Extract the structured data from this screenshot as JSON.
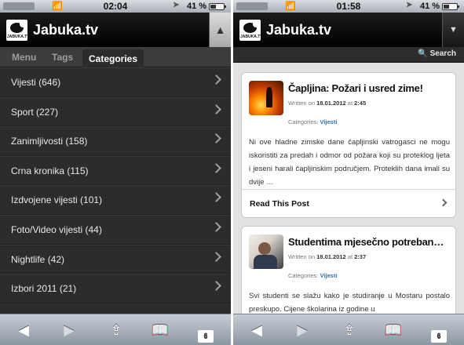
{
  "app": {
    "site_title": "Jabuka.tv",
    "logo_text": "JABUKA.TV"
  },
  "left": {
    "status": {
      "time": "02:04",
      "battery": "41 %"
    },
    "header_button_icon": "chevron-up-icon",
    "tabs": [
      {
        "label": "Menu",
        "active": false
      },
      {
        "label": "Tags",
        "active": false
      },
      {
        "label": "Categories",
        "active": true
      }
    ],
    "categories": [
      "Vijesti (646)",
      "Sport (227)",
      "Zanimljivosti (158)",
      "Crna kronika (115)",
      "Izdvojene vijesti (101)",
      "Foto/Video vijesti (44)",
      "Nightlife (42)",
      "Izbori 2011 (21)"
    ],
    "tabs_count": "6"
  },
  "right": {
    "status": {
      "time": "01:58",
      "battery": "41 %"
    },
    "header_button_icon": "caret-down-icon",
    "search_label": "Search",
    "posts": [
      {
        "title": "Čapljina: Požari i usred zime!",
        "written_prefix": "Written on",
        "date": "18.01.2012",
        "at": "at",
        "time": "2:45",
        "categories_label": "Categories:",
        "category": "Vijesti",
        "excerpt": "Ni ove hladne zimske dane čapljinski vatrogasci ne mogu iskoristiti za predah i odmor od požara koji su proteklog ljeta i jeseni harali čapljinskim područjem. Proteklih dana imali su dvije …",
        "read_label": "Read This Post"
      },
      {
        "title": "Studentima mjesečno potreban…",
        "written_prefix": "Written on",
        "date": "18.01.2012",
        "at": "at",
        "time": "2:37",
        "categories_label": "Categories:",
        "category": "Vijesti",
        "excerpt": "Svi studenti se slažu kako je studiranje u Mostaru postalo preskupo. Cijene školarina iz godine u"
      }
    ],
    "tabs_count": "6"
  }
}
